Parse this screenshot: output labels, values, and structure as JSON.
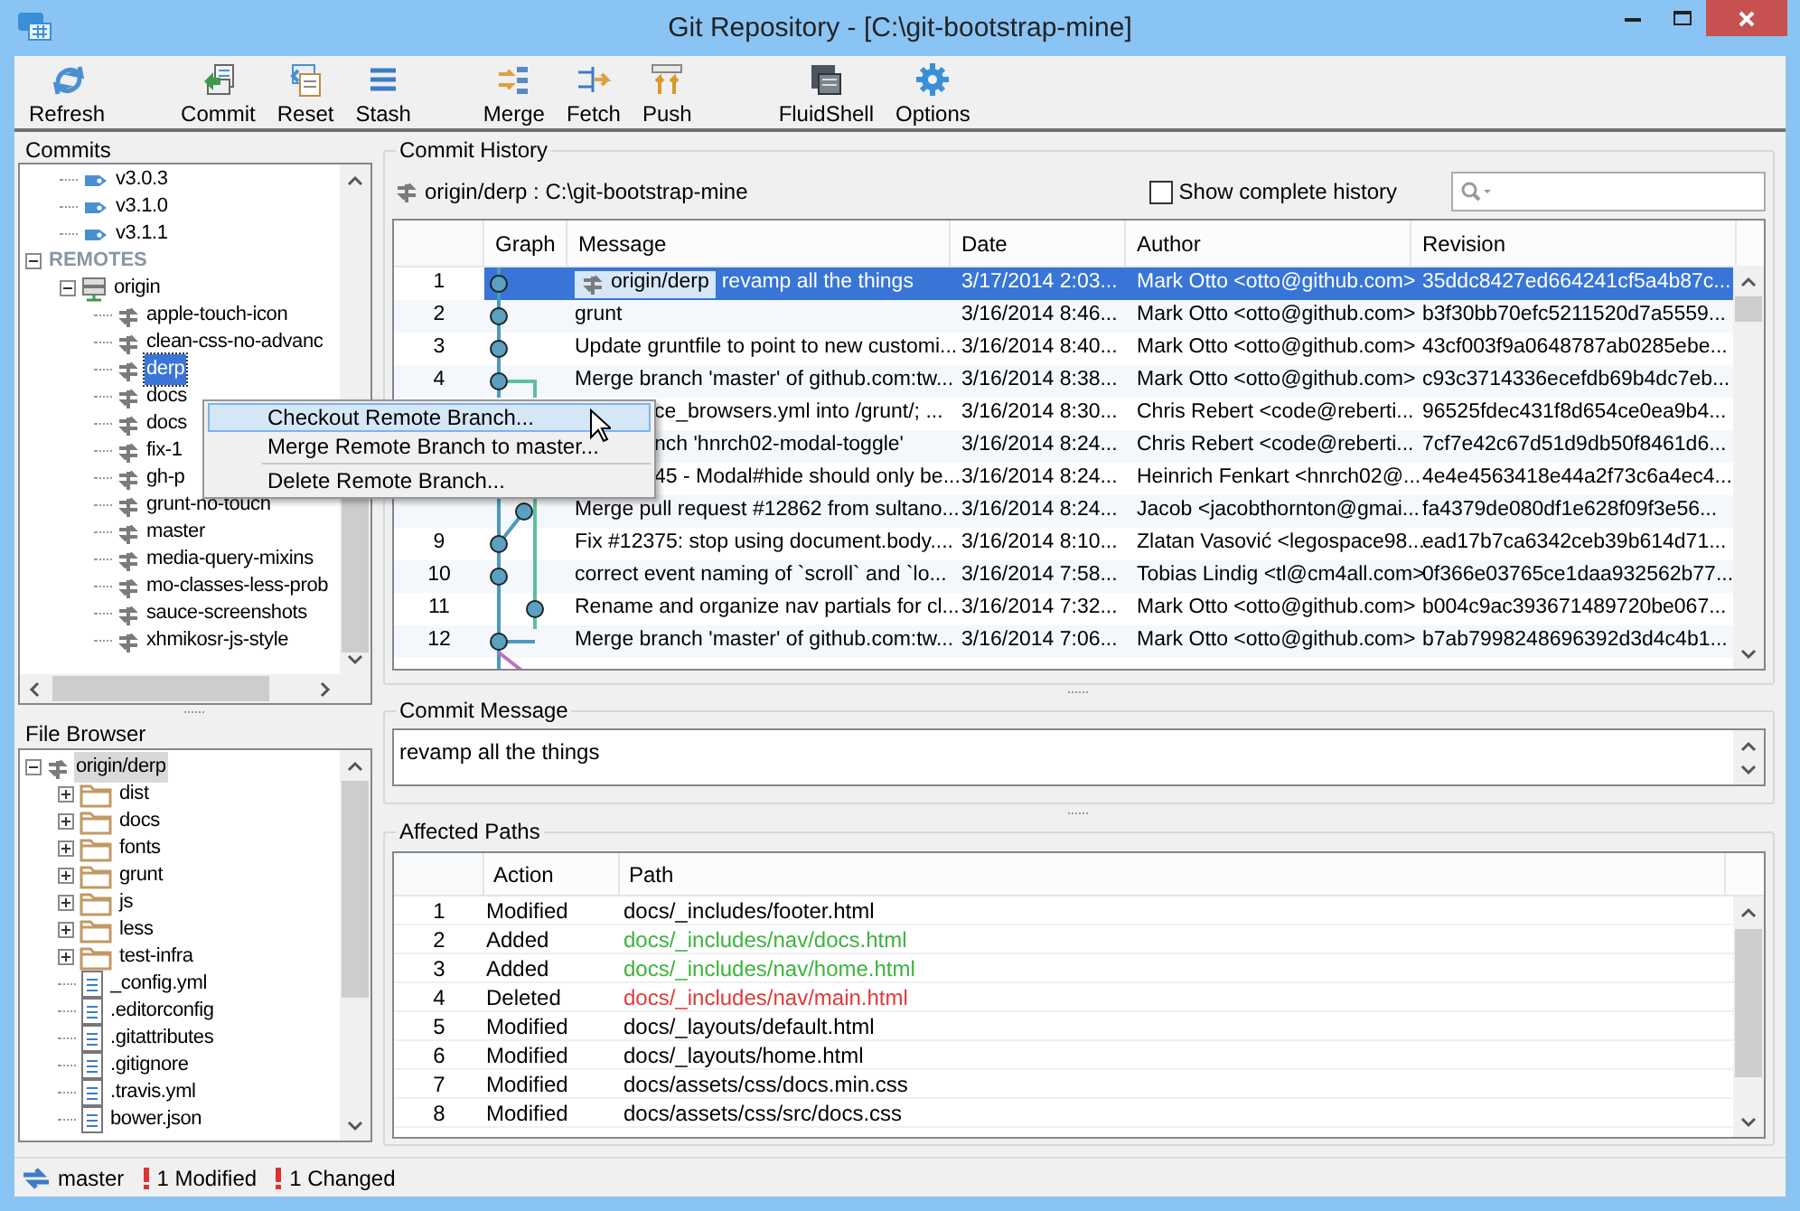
{
  "window": {
    "title": "Git Repository - [C:\\git-bootstrap-mine]"
  },
  "toolbar": {
    "groups": [
      [
        {
          "label": "Refresh"
        }
      ],
      [
        {
          "label": "Commit"
        },
        {
          "label": "Reset"
        },
        {
          "label": "Stash"
        }
      ],
      [
        {
          "label": "Merge"
        },
        {
          "label": "Fetch"
        },
        {
          "label": "Push"
        }
      ],
      [
        {
          "label": "FluidShell"
        },
        {
          "label": "Options"
        }
      ]
    ]
  },
  "commits_panel": {
    "title": "Commits",
    "items": [
      {
        "kind": "tag",
        "label": "v3.0.3",
        "selected": false
      },
      {
        "kind": "tag",
        "label": "v3.1.0",
        "selected": false
      },
      {
        "kind": "tag",
        "label": "v3.1.1",
        "selected": false
      },
      {
        "kind": "section",
        "label": "REMOTES",
        "expanded": true,
        "selected": false,
        "children": [
          {
            "kind": "remote",
            "label": "origin",
            "expanded": true,
            "selected": false,
            "children": [
              {
                "kind": "branch",
                "label": "apple-touch-icon",
                "selected": false
              },
              {
                "kind": "branch",
                "label": "clean-css-no-advanc",
                "selected": false
              },
              {
                "kind": "branch",
                "label": "derp",
                "selected": true
              },
              {
                "kind": "branch",
                "label": "docs",
                "selected": false
              },
              {
                "kind": "branch",
                "label": "docs",
                "selected": false
              },
              {
                "kind": "branch",
                "label": "fix-1",
                "selected": false
              },
              {
                "kind": "branch",
                "label": "gh-p",
                "selected": false
              },
              {
                "kind": "branch",
                "label": "grunt-no-touch",
                "selected": false
              },
              {
                "kind": "branch",
                "label": "master",
                "selected": false
              },
              {
                "kind": "branch",
                "label": "media-query-mixins",
                "selected": false
              },
              {
                "kind": "branch",
                "label": "mo-classes-less-prob",
                "selected": false
              },
              {
                "kind": "branch",
                "label": "sauce-screenshots",
                "selected": false
              },
              {
                "kind": "branch",
                "label": "xhmikosr-js-style",
                "selected": false
              }
            ]
          }
        ]
      }
    ]
  },
  "file_browser": {
    "title": "File Browser",
    "items": [
      {
        "kind": "branch",
        "label": "origin/derp",
        "expanded": true,
        "selected": true,
        "children": [
          {
            "kind": "folder",
            "label": "dist",
            "expanded": false,
            "selected": false
          },
          {
            "kind": "folder",
            "label": "docs",
            "expanded": false,
            "selected": false
          },
          {
            "kind": "folder",
            "label": "fonts",
            "expanded": false,
            "selected": false
          },
          {
            "kind": "folder",
            "label": "grunt",
            "expanded": false,
            "selected": false
          },
          {
            "kind": "folder",
            "label": "js",
            "expanded": false,
            "selected": false
          },
          {
            "kind": "folder",
            "label": "less",
            "expanded": false,
            "selected": false
          },
          {
            "kind": "folder",
            "label": "test-infra",
            "expanded": false,
            "selected": false
          },
          {
            "kind": "file",
            "label": "_config.yml",
            "selected": false
          },
          {
            "kind": "file",
            "label": ".editorconfig",
            "selected": false
          },
          {
            "kind": "file",
            "label": ".gitattributes",
            "selected": false
          },
          {
            "kind": "file",
            "label": ".gitignore",
            "selected": false
          },
          {
            "kind": "file",
            "label": ".travis.yml",
            "selected": false
          },
          {
            "kind": "file",
            "label": "bower.json",
            "selected": false
          }
        ]
      }
    ]
  },
  "commit_history": {
    "title": "Commit  History",
    "branch_path": "origin/derp : C:\\git-bootstrap-mine",
    "show_complete_history": {
      "label": "Show complete history",
      "checked": false
    },
    "columns": [
      "Graph",
      "Message",
      "Date",
      "Author",
      "Revision"
    ],
    "rows": [
      {
        "number": "1",
        "ref": "origin/derp",
        "message": "revamp all the things",
        "date": "3/17/2014 2:03...",
        "author": "Mark Otto <otto@github.com>",
        "revision": "35ddc8427ed664241cf5a4b87c...",
        "selected": true
      },
      {
        "number": "2",
        "message": "grunt",
        "date": "3/16/2014 8:46...",
        "author": "Mark Otto <otto@github.com>",
        "revision": "b3f30bb70efc5211520d7a5559...",
        "selected": false
      },
      {
        "number": "3",
        "message": "Update gruntfile to point to new customi...",
        "date": "3/16/2014 8:40...",
        "author": "Mark Otto <otto@github.com>",
        "revision": "43cf003f9a0648787ab0285ebe...",
        "selected": false
      },
      {
        "number": "4",
        "message": "Merge branch 'master' of github.com:tw...",
        "date": "3/16/2014 8:38...",
        "author": "Mark Otto <otto@github.com>",
        "revision": "c93c3714336ecefdb69b4dc7eb...",
        "selected": false
      },
      {
        "kind": "covered",
        "message": "ce_browsers.yml into /grunt/; ...",
        "date": "3/16/2014 8:30...",
        "author": "Chris Rebert <code@reberti...",
        "revision": "96525fdec431f8d654ce0ea9b4...",
        "selected": false
      },
      {
        "kind": "covered",
        "message": "nch 'hnrch02-modal-toggle'",
        "date": "3/16/2014 8:24...",
        "author": "Chris Rebert <code@reberti...",
        "revision": "7cf7e42c67d51d9db50f8461d6...",
        "selected": false
      },
      {
        "kind": "covered",
        "message": "45 - Modal#hide should only be...",
        "date": "3/16/2014 8:24...",
        "author": "Heinrich Fenkart <hnrch02@...",
        "revision": "4e4e4563418e44a2f73c6a4ec4...",
        "selected": false
      },
      {
        "message": "Merge pull request #12862 from sultano...",
        "date": "3/16/2014 8:24...",
        "author": "Jacob <jacobthornton@gmai...",
        "revision": "fa4379de080df1e628f09f3e56...",
        "selected": false
      },
      {
        "number": "9",
        "message": "Fix #12375: stop using document.body....",
        "date": "3/16/2014 8:10...",
        "author": "Zlatan Vasović <legospace98...",
        "revision": "ead17b7ca6342ceb39b614d71...",
        "selected": false
      },
      {
        "number": "10",
        "message": "correct event naming of `scroll` and `lo...",
        "date": "3/16/2014 7:58...",
        "author": "Tobias Lindig <tl@cm4all.com>",
        "revision": "0f366e03765ce1daa932562b77...",
        "selected": false
      },
      {
        "number": "11",
        "message": "Rename and organize nav partials for cl...",
        "date": "3/16/2014 7:32...",
        "author": "Mark Otto <otto@github.com>",
        "revision": "b004c9ac393671489720be067...",
        "selected": false
      },
      {
        "number": "12",
        "message": "Merge branch 'master' of github.com:tw...",
        "date": "3/16/2014 7:06...",
        "author": "Mark Otto <otto@github.com>",
        "revision": "b7ab7998248696392d3d4c4b1...",
        "selected": false
      }
    ]
  },
  "commit_message": {
    "title": "Commit Message",
    "text": "revamp all the things"
  },
  "affected_paths": {
    "title": "Affected Paths",
    "columns": [
      "Action",
      "Path"
    ],
    "rows": [
      {
        "number": "1",
        "action": "Modified",
        "path": "docs/_includes/footer.html",
        "color": "#000000"
      },
      {
        "number": "2",
        "action": "Added",
        "path": "docs/_includes/nav/docs.html",
        "color": "#3cb43c"
      },
      {
        "number": "3",
        "action": "Added",
        "path": "docs/_includes/nav/home.html",
        "color": "#3cb43c"
      },
      {
        "number": "4",
        "action": "Deleted",
        "path": "docs/_includes/nav/main.html",
        "color": "#e03a3a"
      },
      {
        "number": "5",
        "action": "Modified",
        "path": "docs/_layouts/default.html",
        "color": "#000000"
      },
      {
        "number": "6",
        "action": "Modified",
        "path": "docs/_layouts/home.html",
        "color": "#000000"
      },
      {
        "number": "7",
        "action": "Modified",
        "path": "docs/assets/css/docs.min.css",
        "color": "#000000"
      },
      {
        "number": "8",
        "action": "Modified",
        "path": "docs/assets/css/src/docs.css",
        "color": "#000000"
      }
    ]
  },
  "context_menu": {
    "items": [
      {
        "label": "Checkout Remote Branch...",
        "selected": true
      },
      {
        "label": "Merge Remote Branch to master...",
        "selected": false,
        "separator_after": true
      },
      {
        "label": "Delete Remote Branch...",
        "selected": false
      }
    ]
  },
  "status_bar": {
    "branch": "master",
    "items": [
      "1 Modified",
      "1 Changed"
    ]
  }
}
